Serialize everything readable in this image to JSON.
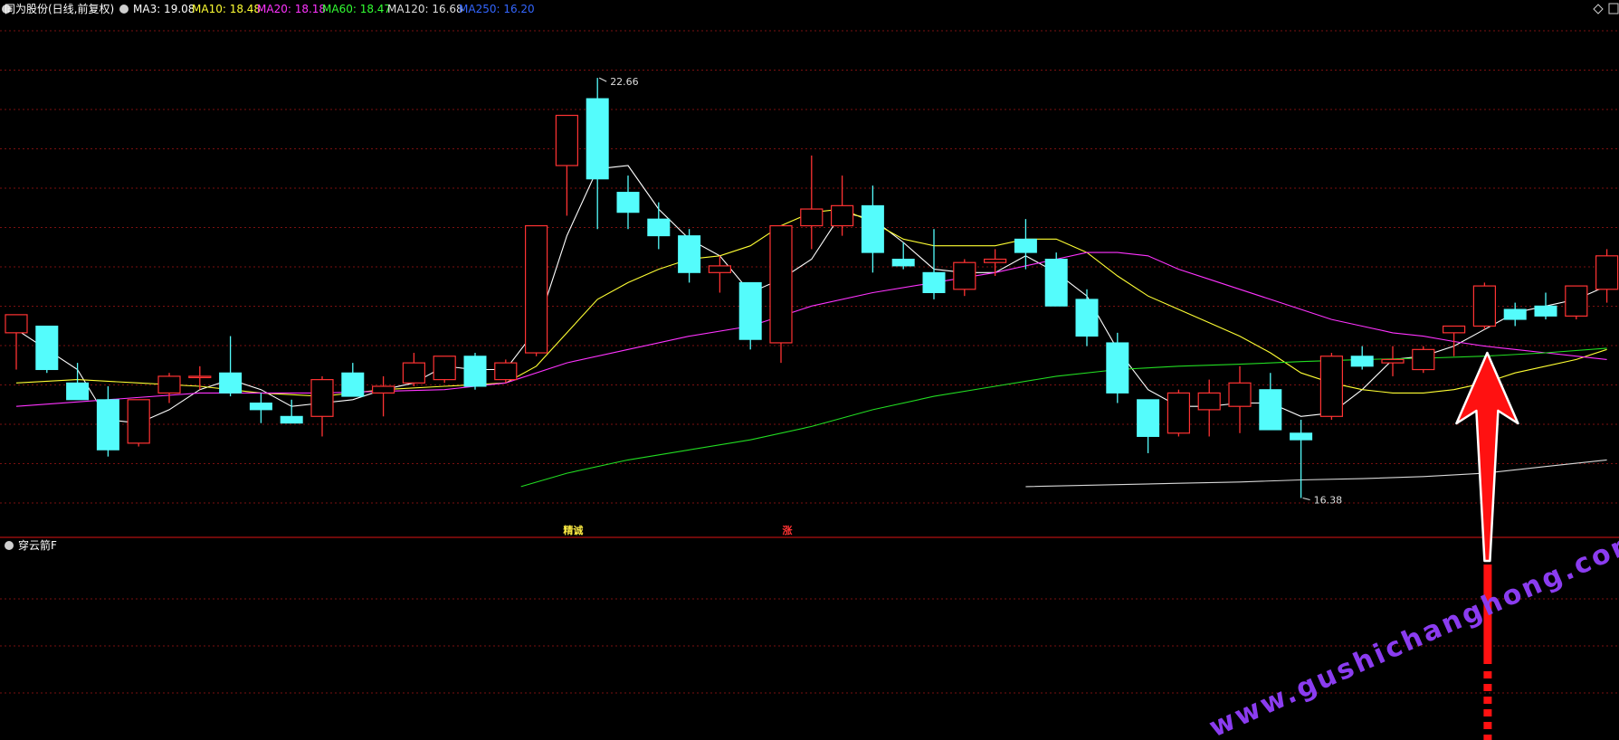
{
  "header": {
    "title": "同为股份(日线,前复权)",
    "ma_items": [
      {
        "label": "MA3: 19.08",
        "color": "#ffffff"
      },
      {
        "label": "MA10: 18.48",
        "color": "#ffff33"
      },
      {
        "label": "MA20: 18.18",
        "color": "#ff33ff"
      },
      {
        "label": "MA60: 18.47",
        "color": "#33ff33"
      },
      {
        "label": "MA120: 16.68",
        "color": "#dddddd"
      },
      {
        "label": "MA250: 16.20",
        "color": "#3366ff"
      }
    ]
  },
  "sub_panel": {
    "title": "穿云箭F"
  },
  "watermark": "www.gushichanghong.com",
  "colors": {
    "up": "#ff3333",
    "down": "#54fcfc",
    "grid": "#7a1010",
    "divider": "#b01010",
    "arrow": "#ff1111",
    "watermark": "#8b3cf0"
  },
  "chart_data": {
    "type": "candlestick",
    "y_range": [
      15.9,
      23.5
    ],
    "candles": [
      {
        "o": 18.85,
        "h": 19.05,
        "l": 18.3,
        "c": 19.12
      },
      {
        "o": 18.95,
        "h": 18.95,
        "l": 18.25,
        "c": 18.3
      },
      {
        "o": 18.1,
        "h": 18.4,
        "l": 17.85,
        "c": 17.85
      },
      {
        "o": 17.85,
        "h": 18.05,
        "l": 17.0,
        "c": 17.1
      },
      {
        "o": 17.2,
        "h": 17.85,
        "l": 17.15,
        "c": 17.85
      },
      {
        "o": 17.95,
        "h": 18.25,
        "l": 17.8,
        "c": 18.2
      },
      {
        "o": 18.2,
        "h": 18.35,
        "l": 18.0,
        "c": 18.2
      },
      {
        "o": 18.25,
        "h": 18.8,
        "l": 17.9,
        "c": 17.95
      },
      {
        "o": 17.8,
        "h": 17.95,
        "l": 17.5,
        "c": 17.7
      },
      {
        "o": 17.6,
        "h": 17.85,
        "l": 17.55,
        "c": 17.5
      },
      {
        "o": 17.6,
        "h": 18.2,
        "l": 17.3,
        "c": 18.15
      },
      {
        "o": 18.25,
        "h": 18.4,
        "l": 17.9,
        "c": 17.9
      },
      {
        "o": 17.95,
        "h": 18.2,
        "l": 17.6,
        "c": 18.05
      },
      {
        "o": 18.1,
        "h": 18.55,
        "l": 18.05,
        "c": 18.4
      },
      {
        "o": 18.15,
        "h": 18.5,
        "l": 18.1,
        "c": 18.5
      },
      {
        "o": 18.5,
        "h": 18.55,
        "l": 18.0,
        "c": 18.05
      },
      {
        "o": 18.15,
        "h": 18.45,
        "l": 18.1,
        "c": 18.4
      },
      {
        "o": 18.55,
        "h": 20.45,
        "l": 18.5,
        "c": 20.45
      },
      {
        "o": 21.35,
        "h": 21.4,
        "l": 20.6,
        "c": 22.1
      },
      {
        "o": 22.35,
        "h": 22.66,
        "l": 20.4,
        "c": 21.15
      },
      {
        "o": 20.95,
        "h": 21.2,
        "l": 20.4,
        "c": 20.65
      },
      {
        "o": 20.55,
        "h": 20.8,
        "l": 20.1,
        "c": 20.3
      },
      {
        "o": 20.3,
        "h": 20.4,
        "l": 19.6,
        "c": 19.75
      },
      {
        "o": 19.75,
        "h": 20.0,
        "l": 19.45,
        "c": 19.85
      },
      {
        "o": 19.6,
        "h": 19.6,
        "l": 18.6,
        "c": 18.75
      },
      {
        "o": 18.7,
        "h": 20.45,
        "l": 18.4,
        "c": 20.45
      },
      {
        "o": 20.45,
        "h": 21.5,
        "l": 20.1,
        "c": 20.7
      },
      {
        "o": 20.45,
        "h": 21.2,
        "l": 20.3,
        "c": 20.75
      },
      {
        "o": 20.75,
        "h": 21.05,
        "l": 19.75,
        "c": 20.05
      },
      {
        "o": 19.95,
        "h": 20.2,
        "l": 19.8,
        "c": 19.85
      },
      {
        "o": 19.75,
        "h": 20.4,
        "l": 19.35,
        "c": 19.45
      },
      {
        "o": 19.5,
        "h": 19.95,
        "l": 19.4,
        "c": 19.9
      },
      {
        "o": 19.9,
        "h": 20.1,
        "l": 19.7,
        "c": 19.95
      },
      {
        "o": 20.25,
        "h": 20.55,
        "l": 19.8,
        "c": 20.05
      },
      {
        "o": 19.95,
        "h": 20.05,
        "l": 19.25,
        "c": 19.25
      },
      {
        "o": 19.35,
        "h": 19.5,
        "l": 18.65,
        "c": 18.8
      },
      {
        "o": 18.7,
        "h": 18.85,
        "l": 17.8,
        "c": 17.95
      },
      {
        "o": 17.85,
        "h": 17.85,
        "l": 17.05,
        "c": 17.3
      },
      {
        "o": 17.35,
        "h": 18.0,
        "l": 17.3,
        "c": 17.95
      },
      {
        "o": 17.7,
        "h": 18.15,
        "l": 17.3,
        "c": 17.95
      },
      {
        "o": 17.75,
        "h": 18.35,
        "l": 17.35,
        "c": 18.1
      },
      {
        "o": 18.0,
        "h": 18.25,
        "l": 17.45,
        "c": 17.4
      },
      {
        "o": 17.35,
        "h": 17.55,
        "l": 16.38,
        "c": 17.25
      },
      {
        "o": 17.6,
        "h": 18.55,
        "l": 17.55,
        "c": 18.5
      },
      {
        "o": 18.5,
        "h": 18.65,
        "l": 18.3,
        "c": 18.35
      },
      {
        "o": 18.4,
        "h": 18.65,
        "l": 18.2,
        "c": 18.45
      },
      {
        "o": 18.3,
        "h": 18.65,
        "l": 18.25,
        "c": 18.6
      },
      {
        "o": 18.85,
        "h": 18.9,
        "l": 18.5,
        "c": 18.95
      },
      {
        "o": 18.95,
        "h": 19.6,
        "l": 18.9,
        "c": 19.55
      },
      {
        "o": 19.2,
        "h": 19.3,
        "l": 18.95,
        "c": 19.05
      },
      {
        "o": 19.25,
        "h": 19.45,
        "l": 19.05,
        "c": 19.1
      },
      {
        "o": 19.1,
        "h": 19.55,
        "l": 19.05,
        "c": 19.55
      },
      {
        "o": 19.5,
        "h": 20.1,
        "l": 19.3,
        "c": 20.0
      }
    ],
    "ma_lines": [
      {
        "name": "MA3",
        "color": "#ffffff",
        "points": [
          [
            0,
            18.9
          ],
          [
            1,
            18.6
          ],
          [
            2,
            18.3
          ],
          [
            3,
            17.55
          ],
          [
            4,
            17.5
          ],
          [
            5,
            17.7
          ],
          [
            6,
            18.0
          ],
          [
            7,
            18.15
          ],
          [
            8,
            18.0
          ],
          [
            9,
            17.75
          ],
          [
            10,
            17.8
          ],
          [
            11,
            17.85
          ],
          [
            12,
            18.0
          ],
          [
            13,
            18.1
          ],
          [
            14,
            18.35
          ],
          [
            15,
            18.3
          ],
          [
            16,
            18.3
          ],
          [
            17,
            18.9
          ],
          [
            18,
            20.3
          ],
          [
            19,
            21.3
          ],
          [
            20,
            21.35
          ],
          [
            21,
            20.7
          ],
          [
            22,
            20.25
          ],
          [
            23,
            20.0
          ],
          [
            24,
            19.45
          ],
          [
            25,
            19.65
          ],
          [
            26,
            19.95
          ],
          [
            27,
            20.65
          ],
          [
            28,
            20.55
          ],
          [
            29,
            20.2
          ],
          [
            30,
            19.8
          ],
          [
            31,
            19.75
          ],
          [
            32,
            19.75
          ],
          [
            33,
            20.0
          ],
          [
            34,
            19.75
          ],
          [
            35,
            19.4
          ],
          [
            36,
            18.6
          ],
          [
            37,
            18.0
          ],
          [
            38,
            17.75
          ],
          [
            39,
            17.75
          ],
          [
            40,
            17.8
          ],
          [
            41,
            17.8
          ],
          [
            42,
            17.6
          ],
          [
            43,
            17.65
          ],
          [
            44,
            18.0
          ],
          [
            45,
            18.45
          ],
          [
            46,
            18.5
          ],
          [
            47,
            18.65
          ],
          [
            48,
            18.9
          ],
          [
            49,
            19.15
          ],
          [
            50,
            19.25
          ],
          [
            51,
            19.35
          ],
          [
            52,
            19.55
          ]
        ]
      },
      {
        "name": "MA10",
        "color": "#ffff33",
        "points": [
          [
            0,
            18.1
          ],
          [
            2,
            18.15
          ],
          [
            4,
            18.1
          ],
          [
            6,
            18.05
          ],
          [
            8,
            17.95
          ],
          [
            10,
            17.9
          ],
          [
            12,
            18.0
          ],
          [
            14,
            18.05
          ],
          [
            16,
            18.1
          ],
          [
            17,
            18.35
          ],
          [
            18,
            18.85
          ],
          [
            19,
            19.35
          ],
          [
            20,
            19.6
          ],
          [
            21,
            19.8
          ],
          [
            22,
            19.95
          ],
          [
            23,
            20.0
          ],
          [
            24,
            20.15
          ],
          [
            25,
            20.45
          ],
          [
            26,
            20.65
          ],
          [
            27,
            20.7
          ],
          [
            28,
            20.5
          ],
          [
            29,
            20.25
          ],
          [
            30,
            20.15
          ],
          [
            31,
            20.15
          ],
          [
            32,
            20.15
          ],
          [
            33,
            20.25
          ],
          [
            34,
            20.25
          ],
          [
            35,
            20.05
          ],
          [
            36,
            19.7
          ],
          [
            37,
            19.4
          ],
          [
            38,
            19.2
          ],
          [
            39,
            19.0
          ],
          [
            40,
            18.8
          ],
          [
            41,
            18.55
          ],
          [
            42,
            18.25
          ],
          [
            43,
            18.1
          ],
          [
            44,
            18.0
          ],
          [
            45,
            17.95
          ],
          [
            46,
            17.95
          ],
          [
            47,
            18.0
          ],
          [
            48,
            18.1
          ],
          [
            49,
            18.25
          ],
          [
            50,
            18.35
          ],
          [
            51,
            18.45
          ],
          [
            52,
            18.6
          ]
        ]
      },
      {
        "name": "MA20",
        "color": "#ff33ff",
        "points": [
          [
            0,
            17.75
          ],
          [
            3,
            17.85
          ],
          [
            6,
            17.95
          ],
          [
            10,
            17.95
          ],
          [
            14,
            18.0
          ],
          [
            16,
            18.1
          ],
          [
            18,
            18.4
          ],
          [
            20,
            18.6
          ],
          [
            22,
            18.8
          ],
          [
            24,
            18.95
          ],
          [
            26,
            19.25
          ],
          [
            28,
            19.45
          ],
          [
            30,
            19.6
          ],
          [
            32,
            19.75
          ],
          [
            34,
            19.95
          ],
          [
            35,
            20.05
          ],
          [
            36,
            20.05
          ],
          [
            37,
            20.0
          ],
          [
            38,
            19.8
          ],
          [
            39,
            19.65
          ],
          [
            40,
            19.5
          ],
          [
            41,
            19.35
          ],
          [
            42,
            19.2
          ],
          [
            43,
            19.05
          ],
          [
            44,
            18.95
          ],
          [
            45,
            18.85
          ],
          [
            46,
            18.8
          ],
          [
            47,
            18.72
          ],
          [
            48,
            18.65
          ],
          [
            49,
            18.6
          ],
          [
            50,
            18.55
          ],
          [
            51,
            18.5
          ],
          [
            52,
            18.45
          ]
        ]
      },
      {
        "name": "MA60",
        "color": "#22dd22",
        "points": [
          [
            16.5,
            16.55
          ],
          [
            18,
            16.75
          ],
          [
            20,
            16.95
          ],
          [
            22,
            17.1
          ],
          [
            24,
            17.25
          ],
          [
            26,
            17.45
          ],
          [
            28,
            17.7
          ],
          [
            30,
            17.9
          ],
          [
            32,
            18.05
          ],
          [
            34,
            18.2
          ],
          [
            36,
            18.3
          ],
          [
            38,
            18.35
          ],
          [
            40,
            18.38
          ],
          [
            42,
            18.42
          ],
          [
            44,
            18.45
          ],
          [
            46,
            18.47
          ],
          [
            48,
            18.5
          ],
          [
            50,
            18.55
          ],
          [
            52,
            18.62
          ]
        ]
      },
      {
        "name": "MA120",
        "color": "#d8d8d8",
        "points": [
          [
            33,
            16.55
          ],
          [
            36,
            16.58
          ],
          [
            38,
            16.6
          ],
          [
            40,
            16.62
          ],
          [
            42,
            16.65
          ],
          [
            44,
            16.67
          ],
          [
            46,
            16.7
          ],
          [
            48,
            16.75
          ],
          [
            50,
            16.85
          ],
          [
            52,
            16.95
          ]
        ]
      }
    ],
    "annotations": {
      "high": {
        "index": 19,
        "value": 22.66,
        "label": "22.66"
      },
      "low": {
        "index": 42,
        "value": 16.38,
        "label": "16.38"
      }
    },
    "signals": [
      {
        "index": 18,
        "label": "精诚",
        "color": "#ffee44"
      },
      {
        "index": 25,
        "label": "涨",
        "color": "#ff3333"
      }
    ],
    "arrow_index": 48
  }
}
